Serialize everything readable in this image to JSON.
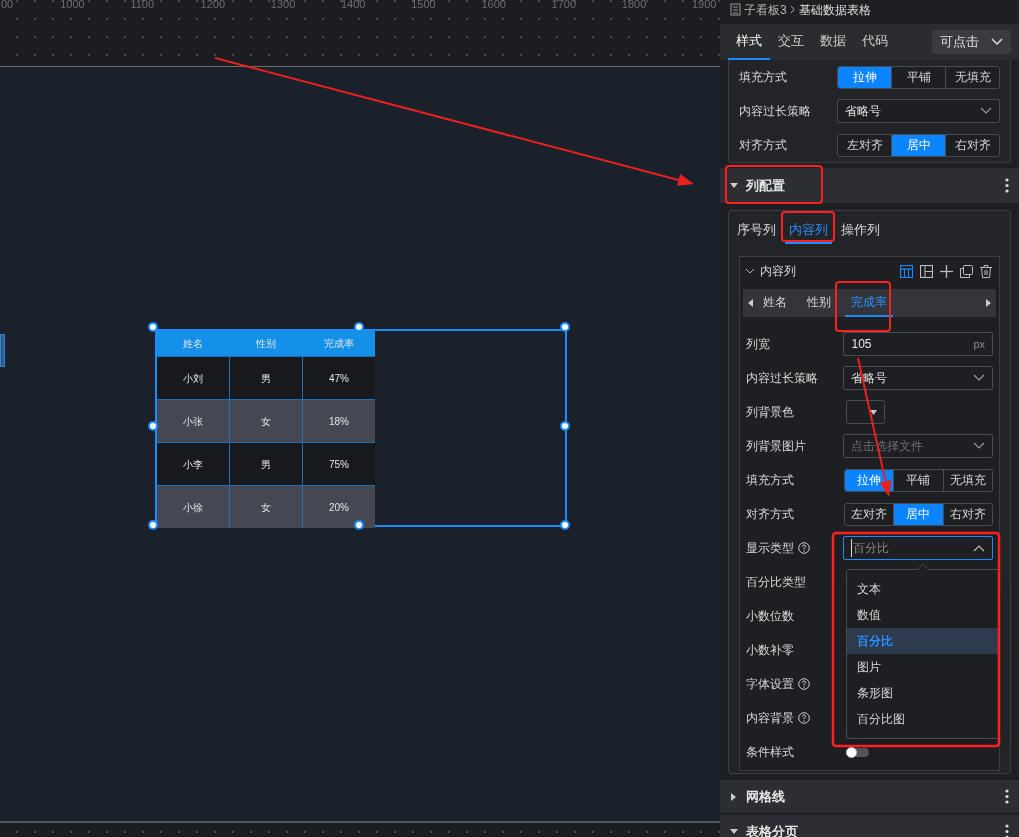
{
  "canvas": {
    "ruler_labels": [
      "00",
      "1000",
      "1100",
      "1200",
      "1300",
      "1400",
      "1500",
      "1600",
      "1700",
      "1800",
      "1900"
    ],
    "table": {
      "columns": [
        "姓名",
        "性别",
        "完成率"
      ],
      "rows": [
        [
          "小刘",
          "男",
          "47%"
        ],
        [
          "小张",
          "女",
          "18%"
        ],
        [
          "小李",
          "男",
          "75%"
        ],
        [
          "小徐",
          "女",
          "20%"
        ]
      ]
    }
  },
  "panel": {
    "breadcrumb": {
      "parent": "子看板3",
      "current": "基础数据表格"
    },
    "tabs": [
      {
        "label": "样式",
        "selected": true
      },
      {
        "label": "交互",
        "selected": false
      },
      {
        "label": "数据",
        "selected": false
      },
      {
        "label": "代码",
        "selected": false
      }
    ],
    "mode_select": {
      "value": "可点击"
    },
    "style_rows": [
      {
        "kind": "segmented",
        "label": "填充方式",
        "options": [
          {
            "label": "拉伸",
            "selected": true
          },
          {
            "label": "平铺",
            "selected": false
          },
          {
            "label": "无填充",
            "selected": false
          }
        ]
      },
      {
        "kind": "select",
        "label": "内容过长策略",
        "value": "省略号"
      },
      {
        "kind": "segmented",
        "label": "对齐方式",
        "options": [
          {
            "label": "左对齐",
            "selected": false
          },
          {
            "label": "居中",
            "selected": true
          },
          {
            "label": "右对齐",
            "selected": false
          }
        ]
      }
    ],
    "column_config": {
      "title": "列配置",
      "expanded": true,
      "tabs": [
        {
          "label": "序号列",
          "selected": false
        },
        {
          "label": "内容列",
          "selected": true
        },
        {
          "label": "操作列",
          "selected": false
        }
      ],
      "group": {
        "title": "内容列",
        "expanded": true,
        "field_tabs": [
          {
            "label": "姓名",
            "selected": false
          },
          {
            "label": "性别",
            "selected": false
          },
          {
            "label": "完成率",
            "selected": true
          }
        ],
        "rows": [
          {
            "kind": "input",
            "label": "列宽",
            "value": "105",
            "unit": "px"
          },
          {
            "kind": "select",
            "label": "内容过长策略",
            "value": "省略号"
          },
          {
            "kind": "color",
            "label": "列背景色"
          },
          {
            "kind": "select",
            "label": "列背景图片",
            "placeholder": "点击选择文件"
          },
          {
            "kind": "segmented",
            "label": "填充方式",
            "options": [
              {
                "label": "拉伸",
                "selected": true
              },
              {
                "label": "平铺",
                "selected": false
              },
              {
                "label": "无填充",
                "selected": false
              }
            ]
          },
          {
            "kind": "segmented",
            "label": "对齐方式",
            "options": [
              {
                "label": "左对齐",
                "selected": false
              },
              {
                "label": "居中",
                "selected": true
              },
              {
                "label": "右对齐",
                "selected": false
              }
            ]
          },
          {
            "kind": "select",
            "label": "显示类型",
            "help": true,
            "value": "百分比",
            "open": true
          },
          {
            "kind": "covered",
            "label": "百分比类型"
          },
          {
            "kind": "covered",
            "label": "小数位数"
          },
          {
            "kind": "covered",
            "label": "小数补零"
          },
          {
            "kind": "covered",
            "label": "字体设置",
            "help": true
          },
          {
            "kind": "covered",
            "label": "内容背景",
            "help": true
          },
          {
            "kind": "toggle",
            "label": "条件样式",
            "on": false
          }
        ]
      },
      "dropdown_options": [
        {
          "label": "文本",
          "selected": false
        },
        {
          "label": "数值",
          "selected": false
        },
        {
          "label": "百分比",
          "selected": true
        },
        {
          "label": "图片",
          "selected": false
        },
        {
          "label": "条形图",
          "selected": false
        },
        {
          "label": "百分比图",
          "selected": false
        }
      ]
    },
    "sections": [
      {
        "title": "网格线",
        "expanded": false
      },
      {
        "title": "表格分页",
        "expanded": true
      }
    ]
  }
}
